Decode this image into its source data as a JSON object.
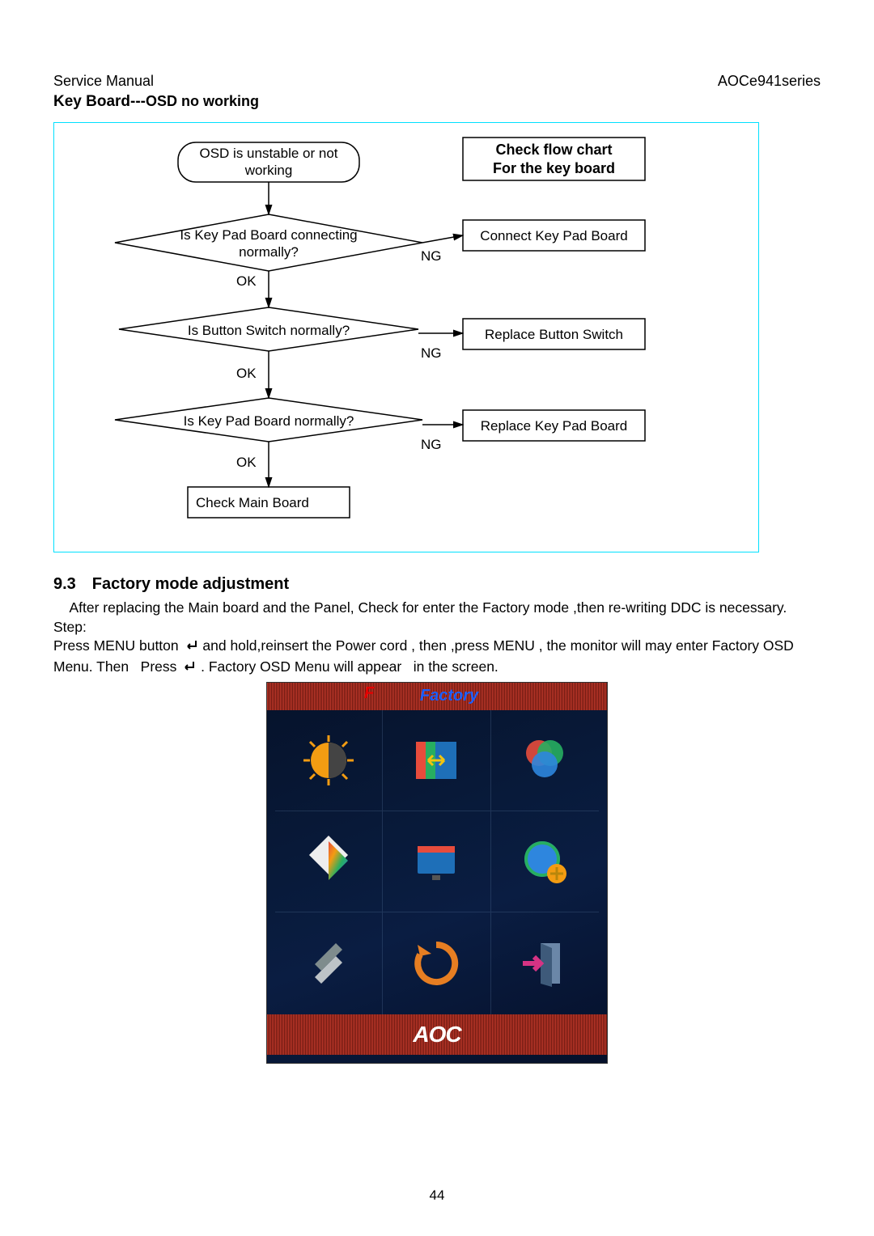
{
  "header": {
    "left": "Service Manual",
    "right": "AOCe941series"
  },
  "section_title_bold": "Key Board---",
  "section_title_rest": "OSD no working",
  "flowchart": {
    "title_line1": "Check flow chart",
    "title_line2": "For the key board",
    "start": "OSD is unstable or not\nworking",
    "d1": "Is Key Pad Board connecting\nnormally?",
    "d2": "Is Button Switch normally?",
    "d3": "Is Key Pad Board normally?",
    "a1": "Connect Key Pad Board",
    "a2": "Replace Button Switch",
    "a3": "Replace Key Pad Board",
    "end": "Check Main Board",
    "ok": "OK",
    "ng": "NG"
  },
  "section93": {
    "heading": "9.3 Factory mode adjustment",
    "p1_pre": "    After replacing the Main board and the Panel, Check for enter the Factory mode ,then re-writing DDC is necessary.",
    "step": "Step:",
    "p2a": "Press MENU button",
    "p2b": " and hold,reinsert the Power cord , then ,press MENU , the monitor will may enter Factory OSD Menu. Then   Press",
    "p2c": " .  Factory OSD Menu will appear   in the screen."
  },
  "osd": {
    "f": "F",
    "factory": "Factory",
    "logo": "AOC",
    "icons": [
      "brightness-icon",
      "image-setup-icon",
      "color-icon",
      "picture-boost-icon",
      "osd-setup-icon",
      "extra-icon",
      "tools-icon",
      "reset-icon",
      "exit-icon"
    ]
  },
  "page_number": "44"
}
